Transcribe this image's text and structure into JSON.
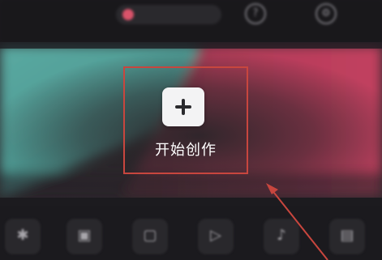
{
  "topbar": {
    "account_label": "",
    "help_label": "",
    "settings_label": "",
    "help_glyph": "?",
    "settings_glyph": "⚙"
  },
  "banner": {
    "start_label": "开始创作",
    "left_color": "#4f9e97",
    "right_color": "#c03e5f",
    "highlight_color": "#c8463e"
  },
  "tools": [
    {
      "name": "tool-1",
      "icon": "effects-icon",
      "glyph": "✱"
    },
    {
      "name": "tool-2",
      "icon": "clip-icon",
      "glyph": "▣"
    },
    {
      "name": "tool-3",
      "icon": "photo-icon",
      "glyph": "▢"
    },
    {
      "name": "tool-4",
      "icon": "play-icon",
      "glyph": "▷"
    },
    {
      "name": "tool-5",
      "icon": "music-icon",
      "glyph": "♪"
    },
    {
      "name": "tool-6",
      "icon": "template-icon",
      "glyph": "▤"
    }
  ]
}
